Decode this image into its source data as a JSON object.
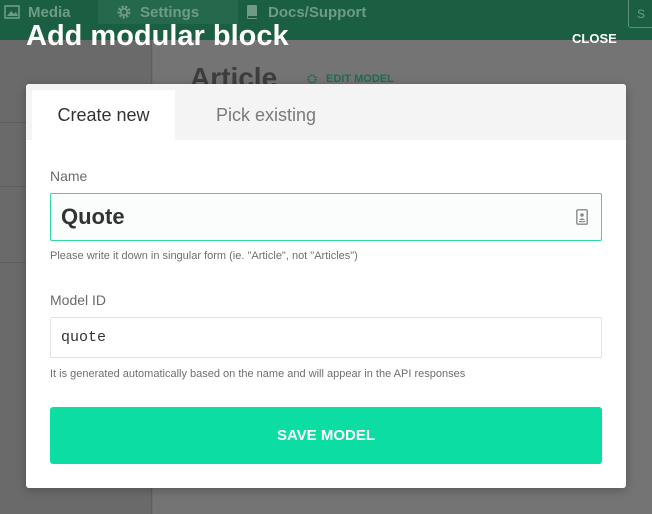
{
  "background": {
    "nav": {
      "media": "Media",
      "settings": "Settings",
      "docs": "Docs/Support",
      "topbar_button": "S"
    },
    "page_title": "Article",
    "edit_model": "EDIT MODEL"
  },
  "modal": {
    "title": "Add modular block",
    "close_label": "CLOSE",
    "tabs": [
      {
        "label": "Create new",
        "active": true
      },
      {
        "label": "Pick existing",
        "active": false
      }
    ],
    "name": {
      "label": "Name",
      "value": "Quote",
      "hint": "Please write it down in singular form (ie. \"Article\", not \"Articles\")"
    },
    "model_id": {
      "label": "Model ID",
      "value": "quote",
      "hint": "It is generated automatically based on the name and will appear in the API responses"
    },
    "save_label": "SAVE MODEL"
  },
  "colors": {
    "accent": "#0bdda3",
    "focus_border": "#2fd9a8",
    "topbar": "#1a5f41"
  },
  "icons": [
    "image-icon",
    "gear-icon",
    "book-icon",
    "contact-card-icon"
  ]
}
